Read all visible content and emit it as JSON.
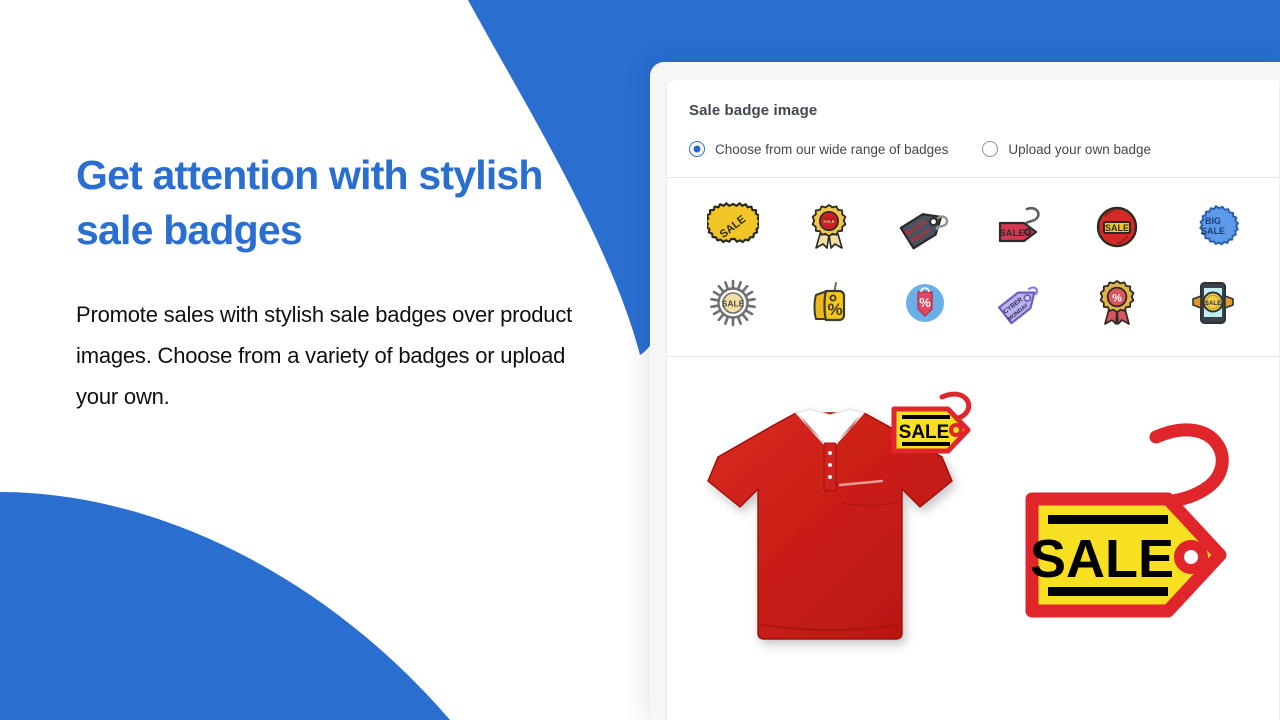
{
  "promo": {
    "headline": "Get attention with stylish sale badges",
    "body": "Promote sales with stylish sale badges over product images. Choose from a variety of badges or upload your own.",
    "accent_color": "#2a6fd0",
    "background_color": "#ffffff"
  },
  "panel": {
    "section_title": "Sale badge image",
    "radio_options": [
      {
        "label": "Choose from our wide range of badges",
        "selected": true
      },
      {
        "label": "Upload your own badge",
        "selected": false
      }
    ],
    "badges": [
      {
        "name": "yellow-starburst-sale-badge",
        "text": "SALE",
        "colors": {
          "fill": "#f2c627",
          "stroke": "#2e2a1d"
        }
      },
      {
        "name": "gold-red-award-rosette-badge",
        "text": "SALE",
        "colors": {
          "fill": "#c8202b",
          "stroke": "#efc64b"
        }
      },
      {
        "name": "black-friday-price-tag-badge",
        "text": "BLACK FRIDAY",
        "colors": {
          "fill": "#4a5160",
          "stroke": "#d32b2b"
        }
      },
      {
        "name": "red-sale-tag-with-hook-badge",
        "text": "SALE",
        "colors": {
          "fill": "#d6384f",
          "stroke": "#2c2c2c"
        }
      },
      {
        "name": "red-circle-sale-stamp-badge",
        "text": "SALE",
        "colors": {
          "fill": "#d42a27",
          "stroke": "#f0c52e"
        }
      },
      {
        "name": "blue-scalloped-big-sale-badge",
        "text": "BIG SALE",
        "colors": {
          "fill": "#5b9bea",
          "stroke": "#2f5fa8"
        }
      },
      {
        "name": "gray-gear-sale-seal-badge",
        "text": "SALE",
        "colors": {
          "fill": "#f3dfa4",
          "stroke": "#6d6f72"
        }
      },
      {
        "name": "yellow-percent-tags-badge",
        "text": "%",
        "colors": {
          "fill": "#f5c518",
          "stroke": "#3d3a2c"
        }
      },
      {
        "name": "blue-circle-percent-tag-badge",
        "text": "%",
        "colors": {
          "fill": "#69b0e8",
          "stroke": "#e0495f"
        }
      },
      {
        "name": "cyber-monday-purple-tag-badge",
        "text": "CYBER MONDAY",
        "colors": {
          "fill": "#b9b4ef",
          "stroke": "#6f5fbe"
        }
      },
      {
        "name": "red-percent-rosette-badge",
        "text": "%",
        "colors": {
          "fill": "#d9555f",
          "stroke": "#e0b44a"
        }
      },
      {
        "name": "mobile-phone-sale-badge",
        "text": "SALE",
        "colors": {
          "fill": "#bfeff2",
          "stroke": "#2e3238"
        }
      }
    ],
    "preview": {
      "product": {
        "name": "red-polo-shirt",
        "color": "#d2241c",
        "collar_color": "#ffffff"
      },
      "overlay_badge": {
        "text": "SALE",
        "fill": "#f7e021",
        "stroke": "#e0262b"
      },
      "large_badge": {
        "text": "SALE",
        "fill": "#f7e021",
        "stroke": "#e0262b",
        "text_color": "#000000"
      }
    }
  }
}
